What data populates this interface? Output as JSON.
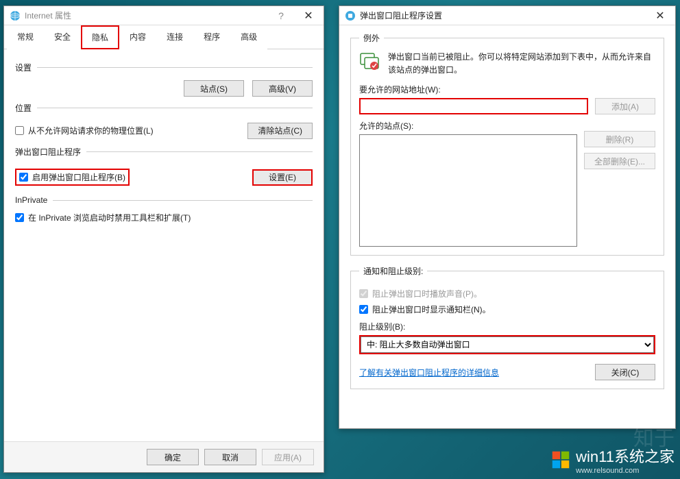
{
  "window1": {
    "title": "Internet 属性",
    "tabs": [
      "常规",
      "安全",
      "隐私",
      "内容",
      "连接",
      "程序",
      "高级"
    ],
    "active_tab_index": 2,
    "sections": {
      "settings": {
        "label": "设置",
        "sites_btn": "站点(S)",
        "advanced_btn": "高级(V)"
      },
      "location": {
        "label": "位置",
        "checkbox_label": "从不允许网站请求你的物理位置(L)",
        "checked": false,
        "clear_btn": "清除站点(C)"
      },
      "popup": {
        "label": "弹出窗口阻止程序",
        "checkbox_label": "启用弹出窗口阻止程序(B)",
        "checked": true,
        "settings_btn": "设置(E)"
      },
      "inprivate": {
        "label": "InPrivate",
        "checkbox_label": "在 InPrivate 浏览启动时禁用工具栏和扩展(T)",
        "checked": true
      }
    },
    "footer": {
      "ok": "确定",
      "cancel": "取消",
      "apply": "应用(A)"
    }
  },
  "window2": {
    "title": "弹出窗口阻止程序设置",
    "groups": {
      "exceptions": {
        "legend": "例外",
        "description": "弹出窗口当前已被阻止。你可以将特定网站添加到下表中，从而允许来自该站点的弹出窗口。",
        "address_label": "要允许的网站地址(W):",
        "add_btn": "添加(A)",
        "allowed_label": "允许的站点(S):",
        "remove_btn": "删除(R)",
        "remove_all_btn": "全部删除(E)..."
      },
      "notify": {
        "legend": "通知和阻止级别:",
        "sound_label": "阻止弹出窗口时播放声音(P)。",
        "sound_checked": true,
        "notifybar_label": "阻止弹出窗口时显示通知栏(N)。",
        "notifybar_checked": true,
        "level_label": "阻止级别(B):",
        "level_value": "中: 阻止大多数自动弹出窗口",
        "info_link": "了解有关弹出窗口阻止程序的详细信息",
        "close_btn": "关闭(C)"
      }
    }
  },
  "watermarks": {
    "top": "知于",
    "site": "win11系统之家",
    "url": "www.relsound.com"
  }
}
